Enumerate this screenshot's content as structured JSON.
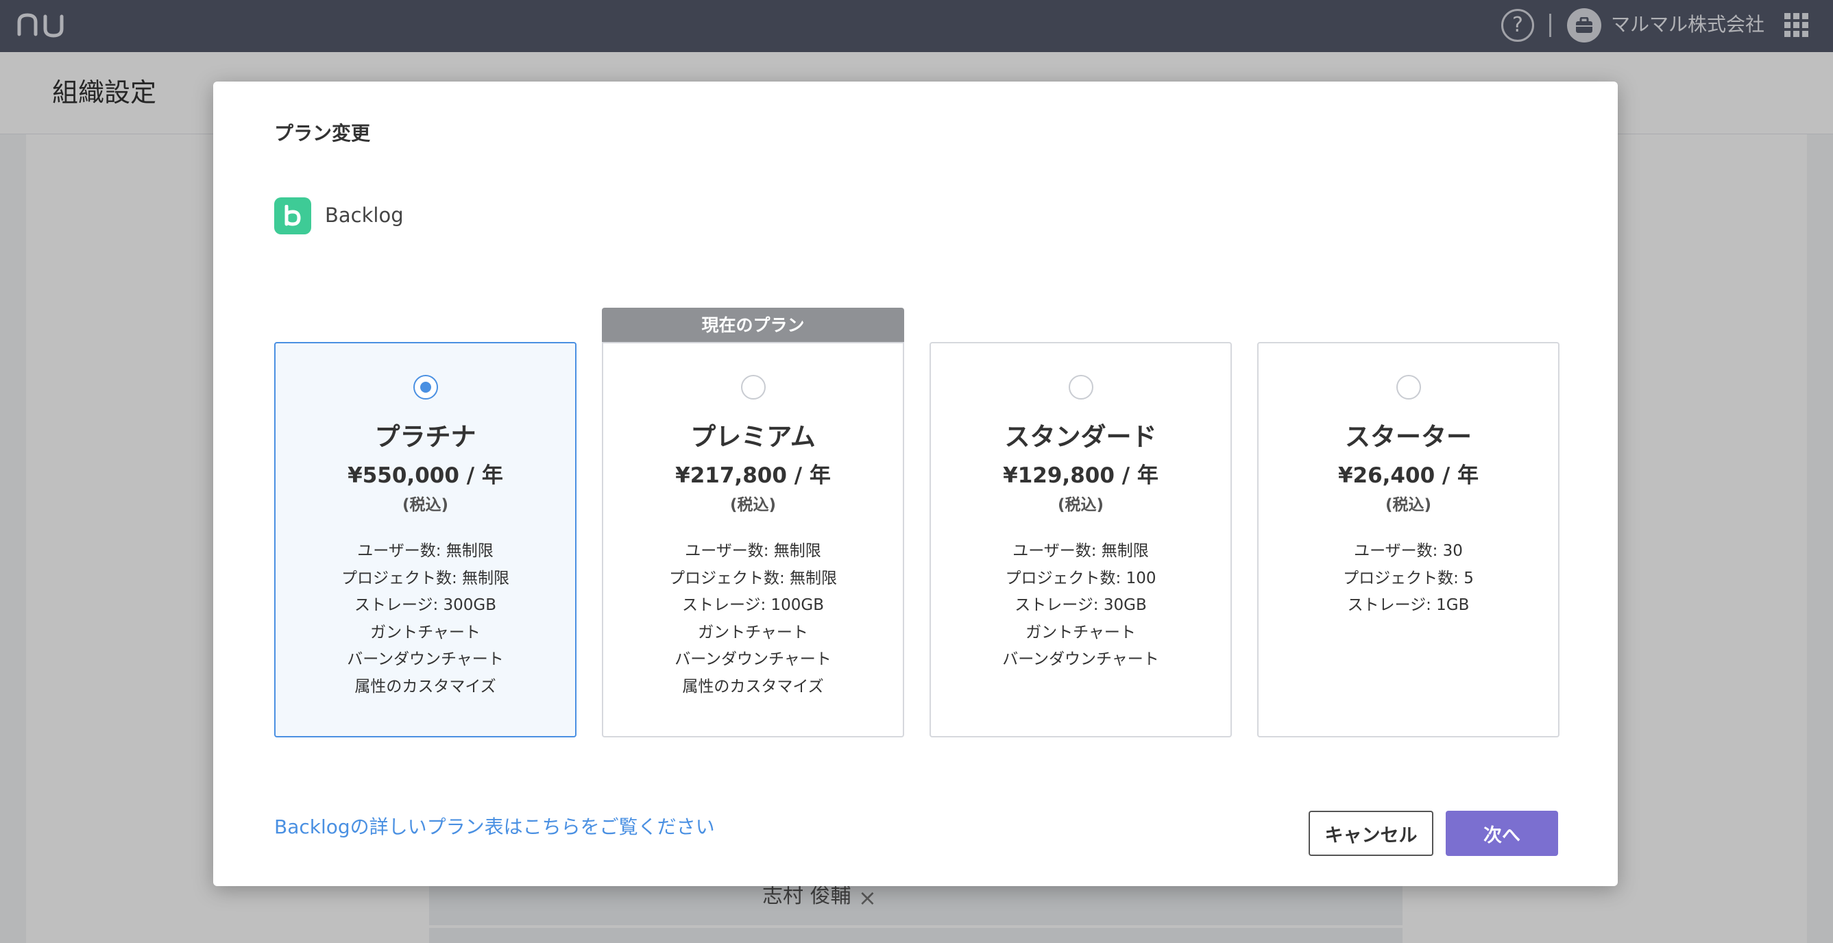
{
  "topbar": {
    "logo_icon": "nu-logo",
    "help_label": "?",
    "org_name": "マルマル株式会社",
    "org_icon": "briefcase-icon",
    "apps_icon": "grid-apps-icon"
  },
  "page": {
    "title": "組織設定"
  },
  "background": {
    "user_name": "志村 俊輔",
    "remove_label": "×"
  },
  "modal": {
    "title": "プラン変更",
    "product": {
      "name": "Backlog",
      "icon": "backlog-b-icon",
      "color": "#3ecb96"
    },
    "current_plan_badge": "現在のプラン",
    "plans": [
      {
        "name": "プラチナ",
        "price": "¥550,000 / 年",
        "tax": "(税込)",
        "selected": true,
        "features": [
          "ユーザー数: 無制限",
          "プロジェクト数: 無制限",
          "ストレージ: 300GB",
          "ガントチャート",
          "バーンダウンチャート",
          "属性のカスタマイズ"
        ]
      },
      {
        "name": "プレミアム",
        "price": "¥217,800 / 年",
        "tax": "(税込)",
        "current": true,
        "features": [
          "ユーザー数: 無制限",
          "プロジェクト数: 無制限",
          "ストレージ: 100GB",
          "ガントチャート",
          "バーンダウンチャート",
          "属性のカスタマイズ"
        ]
      },
      {
        "name": "スタンダード",
        "price": "¥129,800 / 年",
        "tax": "(税込)",
        "features": [
          "ユーザー数: 無制限",
          "プロジェクト数: 100",
          "ストレージ: 30GB",
          "ガントチャート",
          "バーンダウンチャート"
        ]
      },
      {
        "name": "スターター",
        "price": "¥26,400 / 年",
        "tax": "(税込)",
        "features": [
          "ユーザー数: 30",
          "プロジェクト数: 5",
          "ストレージ: 1GB"
        ]
      }
    ],
    "detail_link": "Backlogの詳しいプラン表はこちらをご覧ください",
    "cancel_label": "キャンセル",
    "next_label": "次へ"
  },
  "colors": {
    "topbar": "#555a6b",
    "accent_blue": "#4a90e2",
    "next_button": "#7b6fd0",
    "current_badge": "#8f9195"
  }
}
